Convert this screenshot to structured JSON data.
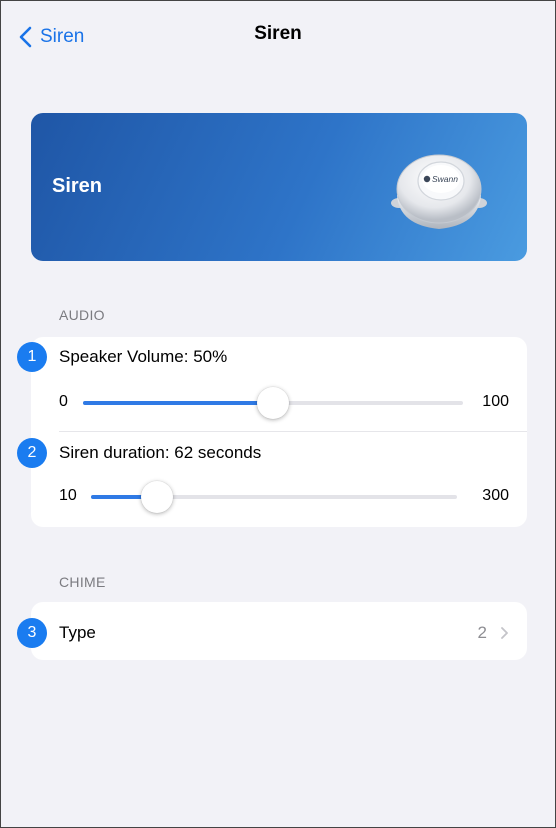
{
  "nav": {
    "back_label": "Siren",
    "title": "Siren"
  },
  "banner": {
    "title": "Siren",
    "device_logo_text": "Swann"
  },
  "audio": {
    "section_label": "AUDIO",
    "speaker_volume": {
      "badge": "1",
      "label": "Speaker Volume: 50%",
      "min": "0",
      "max": "100",
      "value_fraction": 0.5
    },
    "siren_duration": {
      "badge": "2",
      "label": "Siren duration: 62 seconds",
      "min": "10",
      "max": "300",
      "value_fraction": 0.179
    }
  },
  "chime": {
    "section_label": "CHIME",
    "type": {
      "badge": "3",
      "label": "Type",
      "value": "2"
    }
  },
  "colors": {
    "accent": "#1a73e8",
    "badge": "#1a7cf0",
    "slider_fill": "#2f7ae5",
    "background": "#f2f2f7",
    "banner_start": "#1f56a6",
    "banner_end": "#4a9be0"
  },
  "icons": {
    "back": "chevron-left-icon",
    "disclosure": "chevron-right-icon"
  }
}
